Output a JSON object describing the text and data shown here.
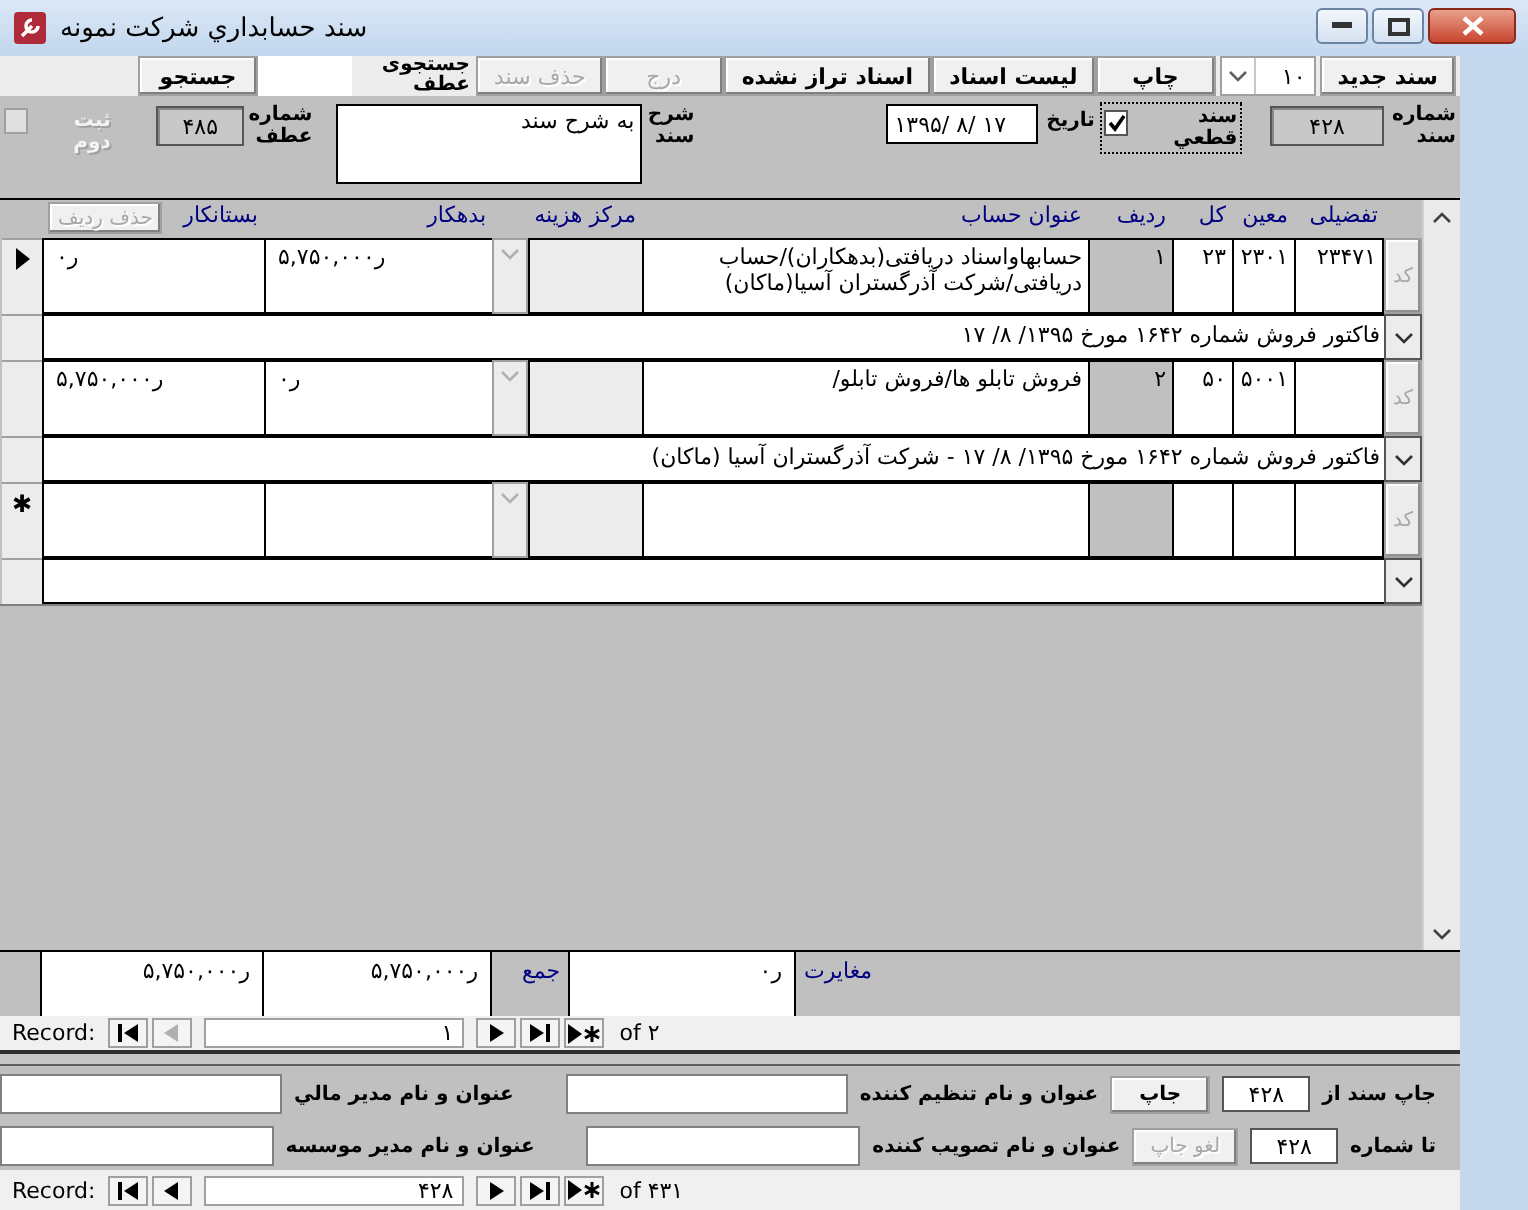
{
  "window": {
    "title": "سند حسابداري شرکت نمونه"
  },
  "toolbar": [
    {
      "kind": "button",
      "label": "سند جدید",
      "disabled": false
    },
    {
      "kind": "combo",
      "value": "۱۰"
    },
    {
      "kind": "button",
      "label": "چاپ",
      "disabled": false
    },
    {
      "kind": "button",
      "label": "لیست اسناد",
      "disabled": false
    },
    {
      "kind": "button",
      "label": "اسناد تراز نشده",
      "disabled": false
    },
    {
      "kind": "button",
      "label": "درج",
      "disabled": true
    },
    {
      "kind": "button",
      "label": "حذف سند",
      "disabled": true
    },
    {
      "kind": "label",
      "label": "جستجوی عطف"
    },
    {
      "kind": "field"
    },
    {
      "kind": "button",
      "label": "جستجو",
      "disabled": false
    }
  ],
  "header": {
    "number": {
      "label": "شماره سند",
      "value": "۴۲۸"
    },
    "final": {
      "label": "سند قطعي",
      "checked": true
    },
    "date": {
      "label": "تاریخ",
      "value": "۱۳۹۵/ ۸/ ۱۷"
    },
    "description": {
      "label": "شرح سند",
      "value": "به شرح سند"
    },
    "reference": {
      "label": "شماره عطف",
      "value": "۴۸۵"
    },
    "second_entry": {
      "label": "ثبت دوم",
      "checked": false,
      "disabled": true
    }
  },
  "lines": {
    "columns": [
      "تفضیلی",
      "معین",
      "کل",
      "ردیف",
      "عنوان حساب",
      "مرکز هزینه",
      "بدهکار",
      "بستانکار"
    ],
    "delete_button": {
      "label": "حذف ردیف",
      "disabled": true
    },
    "rows": [
      {
        "code_button": "کد",
        "detail": "۲۳۴۷۱",
        "subsidiary": "۲۳۰۱",
        "general": "۲۳",
        "row": "۱",
        "account": "حسابهاواسناد دریافتی(بدهکاران)/حساب دریافتی/شرکت آذرگستران آسیا(ماکان)",
        "debit": "۵,۷۵۰,۰۰۰ر",
        "credit": "۰ر",
        "description": "فاکتور فروش  شماره ۱۶۴۲ مورخ ۱۳۹۵/ ۸/ ۱۷",
        "current": true
      },
      {
        "code_button": "کد",
        "subsidiary": "۵۰۰۱",
        "general": "۵۰",
        "row": "۲",
        "account": "فروش تابلو ها/فروش تابلو/",
        "debit": "۰ر",
        "credit": "۵,۷۵۰,۰۰۰ر",
        "description": "فاکتور فروش  شماره ۱۶۴۲ مورخ ۱۳۹۵/ ۸/ ۱۷ - شرکت آذرگستران آسیا (ماکان)",
        "current": false
      }
    ],
    "new_row": {
      "marker": "✱",
      "code_button": "کد"
    },
    "totals": {
      "difference_label": "مغایرت",
      "difference": "۰ر",
      "sum_label": "جمع",
      "debit": "۵,۷۵۰,۰۰۰ر",
      "credit": "۵,۷۵۰,۰۰۰ر"
    },
    "navigator": {
      "label": "Record:",
      "current": "۱",
      "total": "of ۲",
      "prev_disabled": true
    }
  },
  "print": {
    "from_label": "جاپ سند از",
    "from": "۴۲۸",
    "print_button": {
      "label": "جاپ",
      "disabled": false
    },
    "to_label": "تا شماره",
    "to": "۴۲۸",
    "cancel_button": {
      "label": "لغو جاپ",
      "disabled": true
    },
    "signers": [
      {
        "label": "عنوان و نام تنظیم کننده"
      },
      {
        "label": "عنوان و نام  مدیر مالي"
      },
      {
        "label": "عنوان و نام تصویب کننده"
      },
      {
        "label": "عنوان و نام مدیر  موسسه"
      }
    ]
  },
  "navigator": {
    "label": "Record:",
    "current": "۴۲۸",
    "total": "of ۴۳۱",
    "prev_disabled": false
  }
}
